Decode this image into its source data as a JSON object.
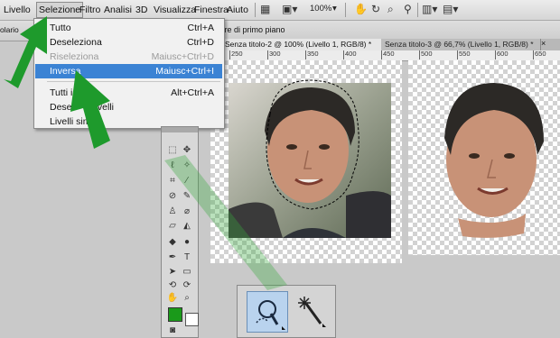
{
  "menubar": {
    "items": [
      "Livello",
      "Selezione",
      "Filtro",
      "Analisi",
      "3D",
      "Visualizza",
      "Finestra",
      "Aiuto"
    ],
    "active": "Selezione",
    "zoom": "100%"
  },
  "optionsbar": {
    "left_text": "olario",
    "right_text": "colore di primo piano"
  },
  "tabs": [
    "Senza titolo-2 @ 100% (Livello 1, RGB/8) *",
    "Senza titolo-3 @ 66,7% (Livello 1, RGB/8) *"
  ],
  "ruler": [
    "250",
    "300",
    "350",
    "400",
    "450",
    "500",
    "550",
    "600",
    "650",
    "700"
  ],
  "menu": {
    "items": [
      {
        "label": "Tutto",
        "shortcut": "Ctrl+A",
        "state": "normal"
      },
      {
        "label": "Deseleziona",
        "shortcut": "Ctrl+D",
        "state": "normal"
      },
      {
        "label": "Riseleziona",
        "shortcut": "Maiusc+Ctrl+D",
        "state": "disabled"
      },
      {
        "label": "Inversa",
        "shortcut": "Maiusc+Ctrl+I",
        "state": "highlighted"
      },
      {
        "label": "Tutti i",
        "shortcut": "Alt+Ctrl+A",
        "state": "normal"
      },
      {
        "label": "Dese",
        "shortcut": "velli",
        "state": "normal"
      },
      {
        "label": "Livelli sim",
        "shortcut": "",
        "state": "normal"
      }
    ]
  },
  "colors": {
    "highlight": "#3b83d4",
    "arrow": "#1e9a2c",
    "foreground": "#1a9a1a"
  }
}
